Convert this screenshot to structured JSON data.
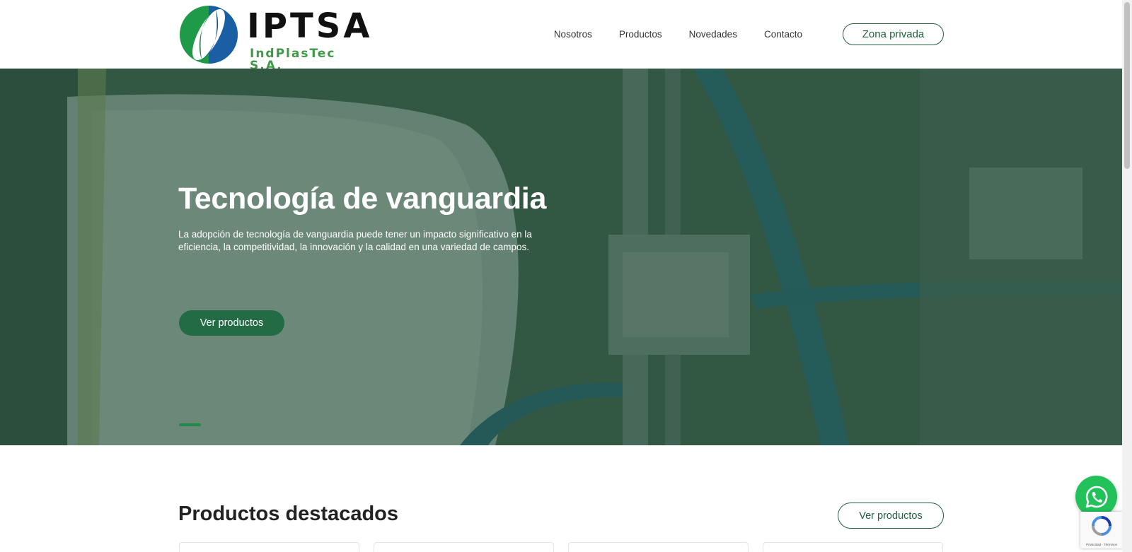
{
  "brand": {
    "name": "IPTSA",
    "tagline": "IndPlasTec S.A.",
    "colors": {
      "green_dark": "#215f3f",
      "green": "#3f9a45",
      "blue": "#1d5f99"
    }
  },
  "nav": {
    "items": [
      {
        "label": "Nosotros"
      },
      {
        "label": "Productos"
      },
      {
        "label": "Novedades"
      },
      {
        "label": "Contacto"
      }
    ],
    "private_label": "Zona privada"
  },
  "hero": {
    "title": "Tecnología de vanguardia",
    "text": "La adopción de tecnología de vanguardia puede tener un impacto significativo en la eficiencia, la competitividad, la innovación y la calidad en una variedad de campos.",
    "button_label": "Ver productos",
    "slide_active": 1,
    "slide_count": 1
  },
  "featured": {
    "title": "Productos destacados",
    "button_label": "Ver productos"
  },
  "widgets": {
    "whatsapp_icon": "whatsapp-icon",
    "recaptcha_links": "Privacidad - Términos"
  }
}
